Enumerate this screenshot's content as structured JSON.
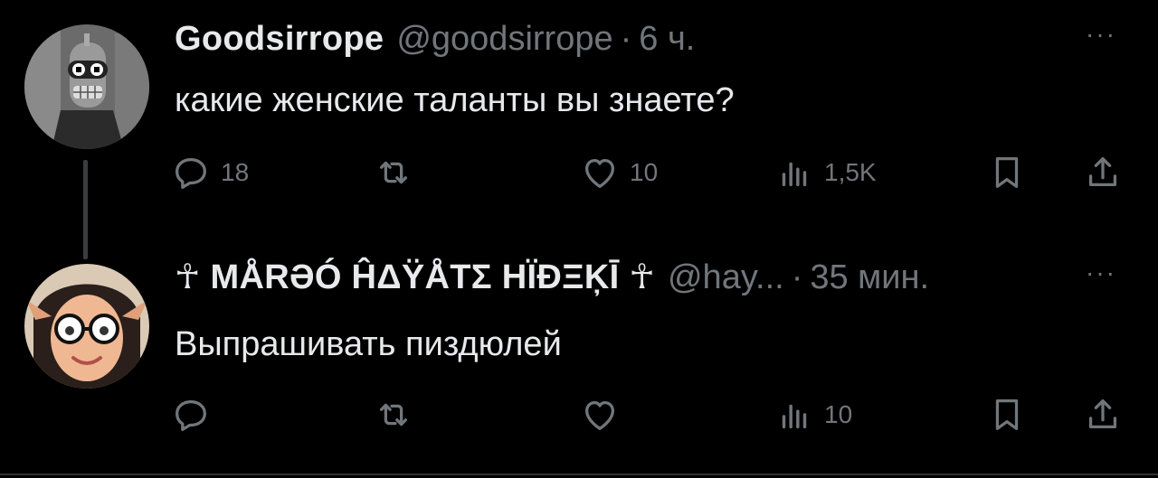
{
  "tweets": [
    {
      "name": "Goodsirrope",
      "handle": "@goodsirrope",
      "separator": "·",
      "time": "6 ч.",
      "text": "какие женские таланты вы знаете?",
      "more": "···",
      "avatar": "bender-robot-avatar",
      "stats": {
        "replies": "18",
        "retweets": "",
        "likes": "10",
        "views": "1,5K"
      }
    },
    {
      "name": "☥ MÅRƏÓ ĤΔŸÅTΣ HÏÐΞĶĪ ☥",
      "handle": "@hay...",
      "separator": "·",
      "time": "35 мин.",
      "text": "Выпрашивать пиздюлей",
      "more": "···",
      "avatar": "woman-with-glasses-avatar",
      "stats": {
        "replies": "",
        "retweets": "",
        "likes": "",
        "views": "10"
      }
    }
  ],
  "colors": {
    "background": "#000000",
    "text": "#e7e9ea",
    "muted": "#71767b",
    "thread_line": "#3a3d40"
  },
  "icons": [
    "reply-icon",
    "retweet-icon",
    "like-icon",
    "views-icon",
    "bookmark-icon",
    "share-icon",
    "more-icon"
  ]
}
